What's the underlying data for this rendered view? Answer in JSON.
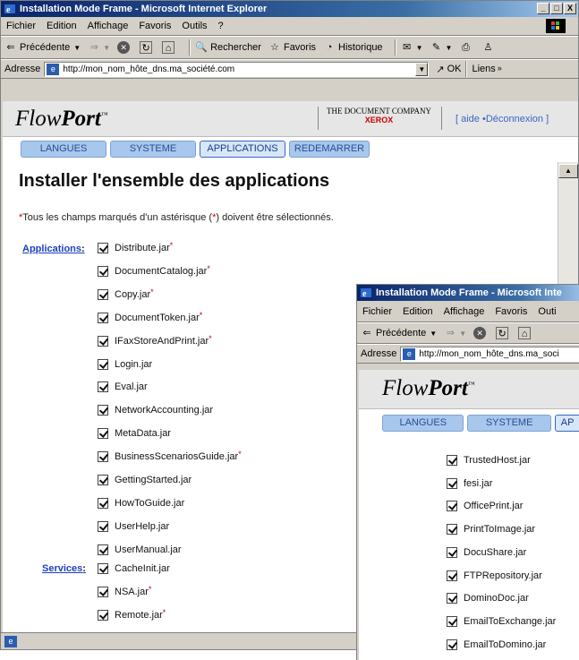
{
  "window1": {
    "title": "Installation Mode Frame - Microsoft Internet Explorer",
    "controls": [
      "_",
      "□",
      "X"
    ],
    "menu": [
      "Fichier",
      "Edition",
      "Affichage",
      "Favoris",
      "Outils",
      "?"
    ],
    "toolbar": {
      "back": "Précédente",
      "search": "Rechercher",
      "favorites": "Favoris",
      "history": "Historique"
    },
    "address": {
      "label": "Adresse",
      "url": "http://mon_nom_hôte_dns.ma_société.com",
      "go": "OK",
      "links": "Liens"
    }
  },
  "flowport": {
    "logo_prefix": "Flow",
    "logo_main": "Port",
    "tm": "™",
    "company_line": "THE DOCUMENT COMPANY",
    "xerox": "XEROX",
    "links": "[ aide •Déconnexion ]",
    "tabs": [
      "LANGUES",
      "SYSTEME",
      "APPLICATIONS",
      "REDEMARRER"
    ],
    "active_tab": "APPLICATIONS"
  },
  "page": {
    "title": "Installer l'ensemble des applications",
    "note_prefix": "Tous les champs marqués d'un astérisque (",
    "note_star": "*",
    "note_suffix": ") doivent être sélectionnés.",
    "applications_label": "Applications",
    "services_label": "Services",
    "applications": [
      {
        "name": "Distribute.jar",
        "required": true
      },
      {
        "name": "DocumentCatalog.jar",
        "required": true
      },
      {
        "name": "Copy.jar",
        "required": true
      },
      {
        "name": "DocumentToken.jar",
        "required": true
      },
      {
        "name": "IFaxStoreAndPrint.jar",
        "required": true
      },
      {
        "name": "Login.jar",
        "required": false
      },
      {
        "name": "Eval.jar",
        "required": false
      },
      {
        "name": "NetworkAccounting.jar",
        "required": false
      },
      {
        "name": "MetaData.jar",
        "required": false
      },
      {
        "name": "BusinessScenariosGuide.jar",
        "required": true
      },
      {
        "name": "GettingStarted.jar",
        "required": false
      },
      {
        "name": "HowToGuide.jar",
        "required": false
      },
      {
        "name": "UserHelp.jar",
        "required": false
      },
      {
        "name": "UserManual.jar",
        "required": false
      }
    ],
    "services": [
      {
        "name": "CacheInit.jar",
        "required": false
      },
      {
        "name": "NSA.jar",
        "required": true
      },
      {
        "name": "Remote.jar",
        "required": true
      }
    ]
  },
  "window2": {
    "title": "Installation Mode Frame - Microsoft Inte",
    "menu": [
      "Fichier",
      "Edition",
      "Affichage",
      "Favoris",
      "Outi"
    ],
    "back": "Précédente",
    "address_label": "Adresse",
    "url": "http://mon_nom_hôte_dns.ma_soci",
    "tabs": [
      "LANGUES",
      "SYSTEME",
      "AP"
    ],
    "items": [
      "TrustedHost.jar",
      "fesi.jar",
      "OfficePrint.jar",
      "PrintToImage.jar",
      "DocuShare.jar",
      "FTPRepository.jar",
      "DominoDoc.jar",
      "EmailToExchange.jar",
      "EmailToDomino.jar"
    ]
  },
  "required_marker": "*"
}
